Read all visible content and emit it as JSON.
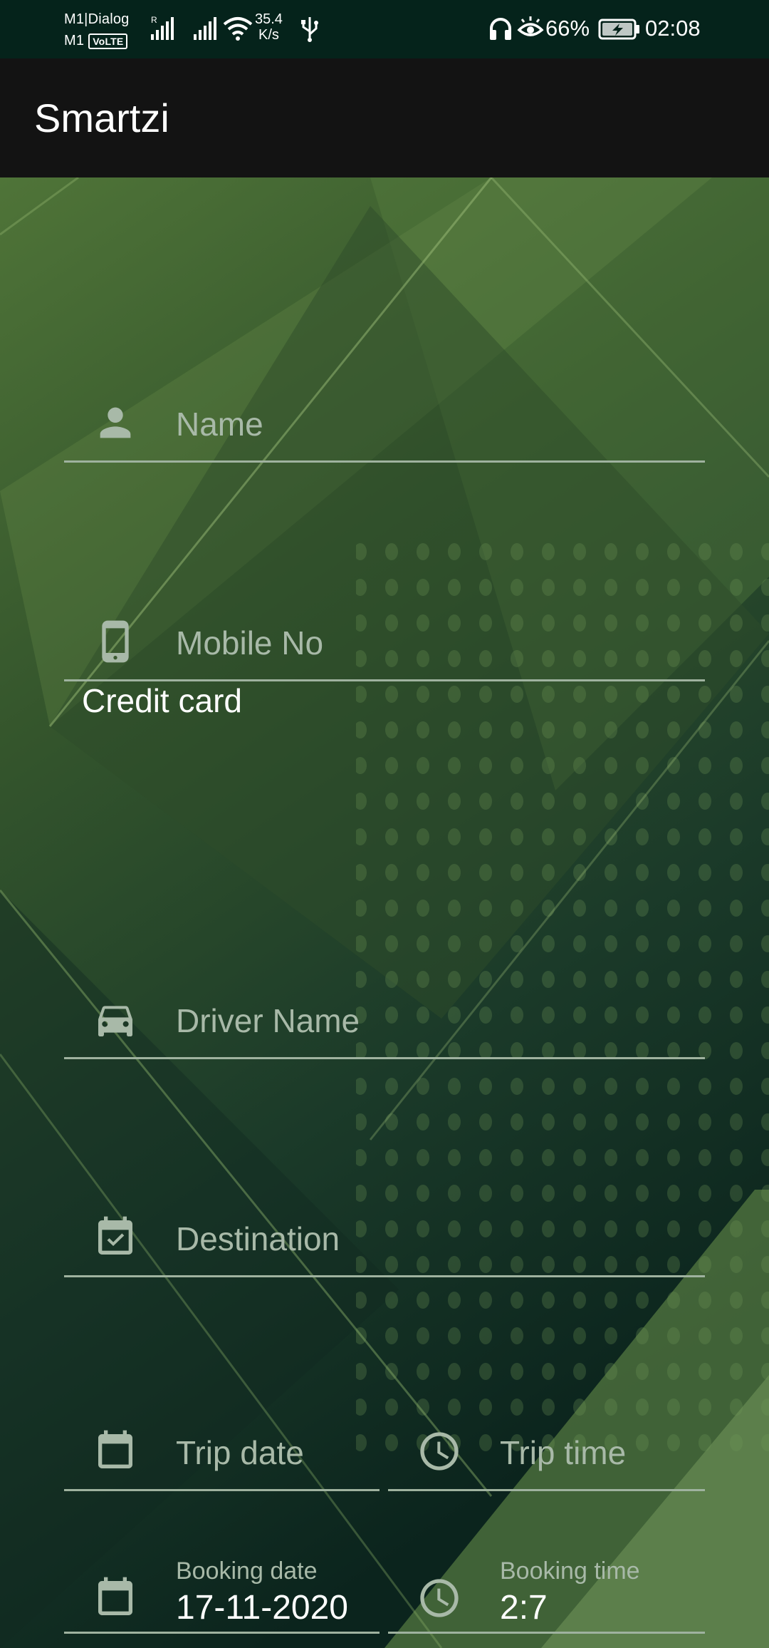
{
  "status_bar": {
    "carrier_line1": "M1|Dialog",
    "carrier_line2": "M1",
    "volte": "VoLTE",
    "net_speed_value": "35.4",
    "net_speed_unit": "K/s",
    "battery_percent": "66%",
    "time": "02:08"
  },
  "app_bar": {
    "title": "Smartzi"
  },
  "form": {
    "name_placeholder": "Name",
    "mobile_placeholder": "Mobile No",
    "credit_card_label": "Credit card",
    "driver_placeholder": "Driver Name",
    "destination_placeholder": "Destination",
    "trip_date_placeholder": "Trip date",
    "trip_time_placeholder": "Trip time",
    "booking_date_label": "Booking date",
    "booking_date_value": "17-11-2020",
    "booking_time_label": "Booking time",
    "booking_time_value": "2:7"
  },
  "colors": {
    "status_bar_bg": "#05231b",
    "app_bar_bg": "#131313",
    "placeholder": "#a8b9a8",
    "underline": "#9fb29f",
    "text_primary": "#ffffff"
  },
  "icons": {
    "name": "person-icon",
    "mobile": "smartphone-icon",
    "driver": "car-icon",
    "destination": "checkbox-icon",
    "trip_date": "calendar-icon",
    "trip_time": "clock-icon",
    "booking_date": "calendar-icon",
    "booking_time": "clock-icon"
  }
}
